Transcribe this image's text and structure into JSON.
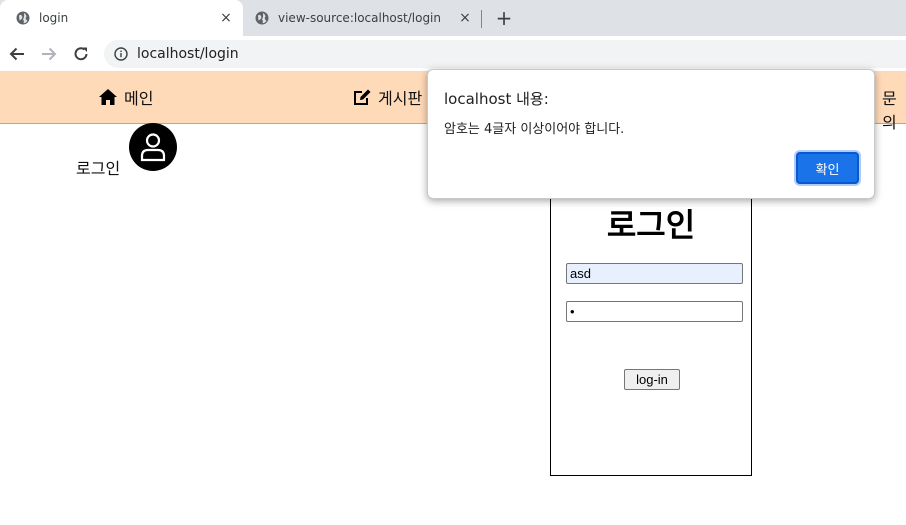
{
  "browser": {
    "tabs": [
      {
        "title": "login",
        "close": "×"
      },
      {
        "title": "view-source:localhost/login",
        "close": "×"
      }
    ],
    "new_tab": "+",
    "url": "localhost/login"
  },
  "site_nav": {
    "items": [
      {
        "label": "메인",
        "icon": "home-icon"
      },
      {
        "label": "게시판",
        "icon": "edit-icon"
      },
      {
        "label": "문의"
      }
    ]
  },
  "page": {
    "login_label": "로그인",
    "avatar_icon": "user-icon",
    "login_box": {
      "title": "로그인",
      "id_value": "asd",
      "password_value": "•",
      "button_label": "log-in"
    }
  },
  "dialog": {
    "title": "localhost 내용:",
    "message": "암호는 4글자 이상이어야 합니다.",
    "ok_label": "확인"
  },
  "colors": {
    "nav_background": "#ffdab9",
    "dialog_button": "#1a73e8"
  }
}
